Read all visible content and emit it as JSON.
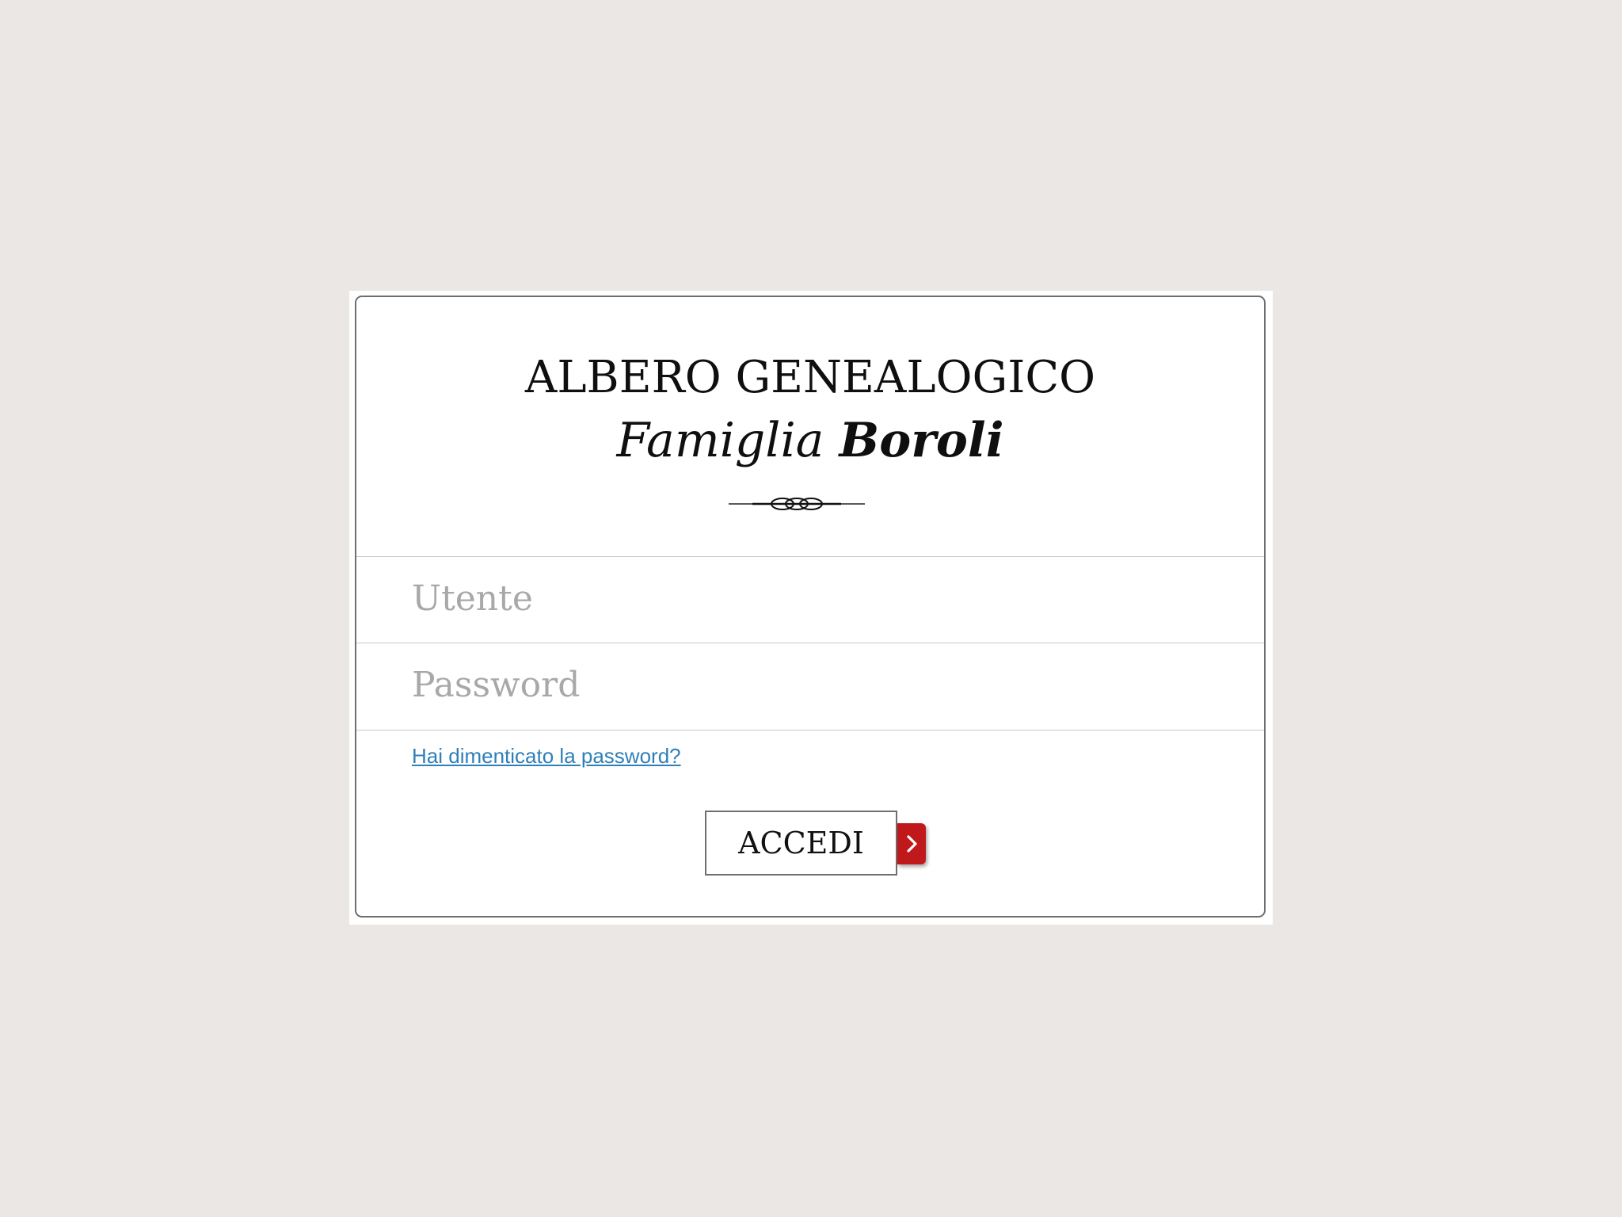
{
  "header": {
    "title": "ALBERO GENEALOGICO",
    "subtitle_prefix": "Famiglia",
    "subtitle_surname": "Boroli"
  },
  "form": {
    "username_placeholder": "Utente",
    "username_value": "",
    "password_placeholder": "Password",
    "password_value": "",
    "forgot_link": "Hai dimenticato la password?",
    "submit_label": "ACCEDI"
  },
  "icons": {
    "ornament": "flourish-divider-icon",
    "submit_arrow": "chevron-right-icon"
  },
  "colors": {
    "page_background": "#ebe7e4",
    "accent_red": "#c0191b",
    "link_blue": "#2f7fb8",
    "placeholder_gray": "#a8a8a8"
  }
}
